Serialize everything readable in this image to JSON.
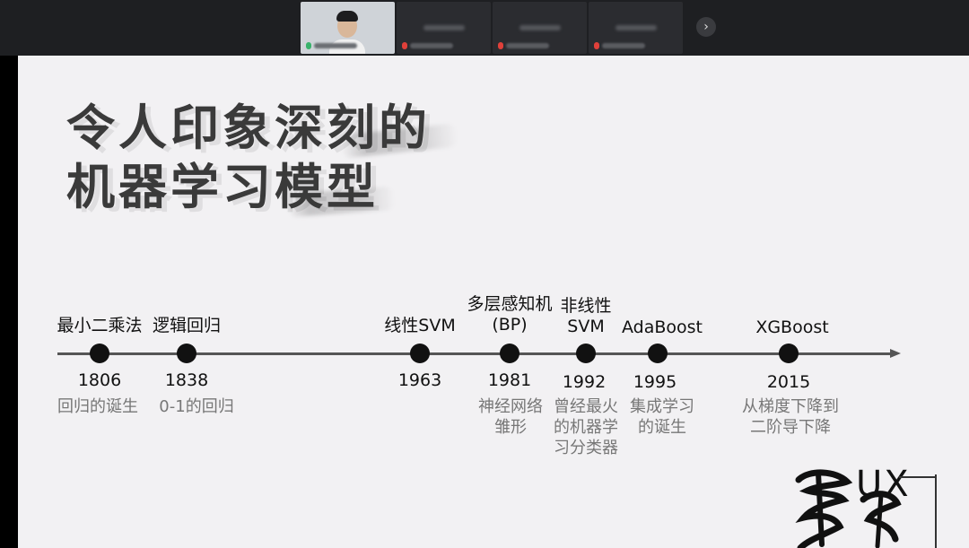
{
  "slide": {
    "title_line1": "令人印象深刻的",
    "title_line2": "机器学习模型"
  },
  "timeline": [
    {
      "label": "最小二乘法",
      "year": "1806",
      "desc": "回归的诞生"
    },
    {
      "label": "逻辑回归",
      "year": "1838",
      "desc": "0-1的回归"
    },
    {
      "label": "线性SVM",
      "year": "1963",
      "desc": ""
    },
    {
      "label": "多层感知机\n(BP)",
      "year": "1981",
      "desc": "神经网络\n雏形"
    },
    {
      "label": "非线性\nSVM",
      "year": "1992",
      "desc": "曾经最火\n的机器学\n习分类器"
    },
    {
      "label": "AdaBoost",
      "year": "1995",
      "desc": "集成学习\n的诞生"
    },
    {
      "label": "XGBoost",
      "year": "2015",
      "desc": "从梯度下降到\n二阶导下降"
    }
  ],
  "watermark": {
    "text": "UX"
  },
  "controls": {
    "next_label": "›"
  }
}
